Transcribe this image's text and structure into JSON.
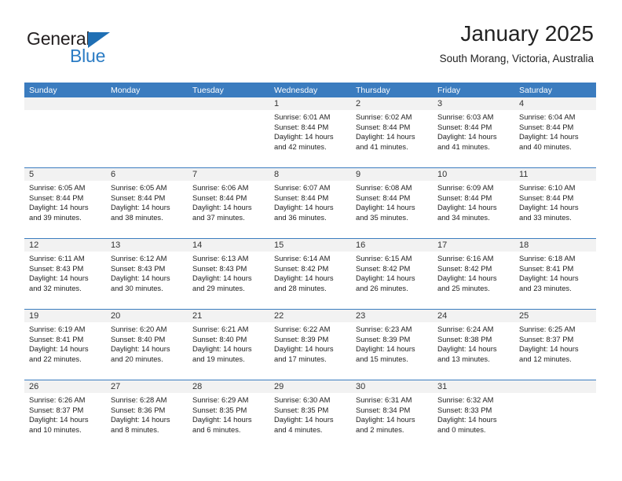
{
  "brand": {
    "name_top": "General",
    "name_bottom": "Blue",
    "accent_color": "#2b7cc4",
    "triangle_color": "#1f6fb4"
  },
  "header": {
    "title": "January 2025",
    "subtitle": "South Morang, Victoria, Australia"
  },
  "calendar": {
    "header_bg": "#3b7cbf",
    "daynum_bg": "#f2f2f2",
    "weekdays": [
      "Sunday",
      "Monday",
      "Tuesday",
      "Wednesday",
      "Thursday",
      "Friday",
      "Saturday"
    ],
    "weeks": [
      [
        {
          "day": "",
          "lines": []
        },
        {
          "day": "",
          "lines": []
        },
        {
          "day": "",
          "lines": []
        },
        {
          "day": "1",
          "lines": [
            "Sunrise: 6:01 AM",
            "Sunset: 8:44 PM",
            "Daylight: 14 hours",
            "and 42 minutes."
          ]
        },
        {
          "day": "2",
          "lines": [
            "Sunrise: 6:02 AM",
            "Sunset: 8:44 PM",
            "Daylight: 14 hours",
            "and 41 minutes."
          ]
        },
        {
          "day": "3",
          "lines": [
            "Sunrise: 6:03 AM",
            "Sunset: 8:44 PM",
            "Daylight: 14 hours",
            "and 41 minutes."
          ]
        },
        {
          "day": "4",
          "lines": [
            "Sunrise: 6:04 AM",
            "Sunset: 8:44 PM",
            "Daylight: 14 hours",
            "and 40 minutes."
          ]
        }
      ],
      [
        {
          "day": "5",
          "lines": [
            "Sunrise: 6:05 AM",
            "Sunset: 8:44 PM",
            "Daylight: 14 hours",
            "and 39 minutes."
          ]
        },
        {
          "day": "6",
          "lines": [
            "Sunrise: 6:05 AM",
            "Sunset: 8:44 PM",
            "Daylight: 14 hours",
            "and 38 minutes."
          ]
        },
        {
          "day": "7",
          "lines": [
            "Sunrise: 6:06 AM",
            "Sunset: 8:44 PM",
            "Daylight: 14 hours",
            "and 37 minutes."
          ]
        },
        {
          "day": "8",
          "lines": [
            "Sunrise: 6:07 AM",
            "Sunset: 8:44 PM",
            "Daylight: 14 hours",
            "and 36 minutes."
          ]
        },
        {
          "day": "9",
          "lines": [
            "Sunrise: 6:08 AM",
            "Sunset: 8:44 PM",
            "Daylight: 14 hours",
            "and 35 minutes."
          ]
        },
        {
          "day": "10",
          "lines": [
            "Sunrise: 6:09 AM",
            "Sunset: 8:44 PM",
            "Daylight: 14 hours",
            "and 34 minutes."
          ]
        },
        {
          "day": "11",
          "lines": [
            "Sunrise: 6:10 AM",
            "Sunset: 8:44 PM",
            "Daylight: 14 hours",
            "and 33 minutes."
          ]
        }
      ],
      [
        {
          "day": "12",
          "lines": [
            "Sunrise: 6:11 AM",
            "Sunset: 8:43 PM",
            "Daylight: 14 hours",
            "and 32 minutes."
          ]
        },
        {
          "day": "13",
          "lines": [
            "Sunrise: 6:12 AM",
            "Sunset: 8:43 PM",
            "Daylight: 14 hours",
            "and 30 minutes."
          ]
        },
        {
          "day": "14",
          "lines": [
            "Sunrise: 6:13 AM",
            "Sunset: 8:43 PM",
            "Daylight: 14 hours",
            "and 29 minutes."
          ]
        },
        {
          "day": "15",
          "lines": [
            "Sunrise: 6:14 AM",
            "Sunset: 8:42 PM",
            "Daylight: 14 hours",
            "and 28 minutes."
          ]
        },
        {
          "day": "16",
          "lines": [
            "Sunrise: 6:15 AM",
            "Sunset: 8:42 PM",
            "Daylight: 14 hours",
            "and 26 minutes."
          ]
        },
        {
          "day": "17",
          "lines": [
            "Sunrise: 6:16 AM",
            "Sunset: 8:42 PM",
            "Daylight: 14 hours",
            "and 25 minutes."
          ]
        },
        {
          "day": "18",
          "lines": [
            "Sunrise: 6:18 AM",
            "Sunset: 8:41 PM",
            "Daylight: 14 hours",
            "and 23 minutes."
          ]
        }
      ],
      [
        {
          "day": "19",
          "lines": [
            "Sunrise: 6:19 AM",
            "Sunset: 8:41 PM",
            "Daylight: 14 hours",
            "and 22 minutes."
          ]
        },
        {
          "day": "20",
          "lines": [
            "Sunrise: 6:20 AM",
            "Sunset: 8:40 PM",
            "Daylight: 14 hours",
            "and 20 minutes."
          ]
        },
        {
          "day": "21",
          "lines": [
            "Sunrise: 6:21 AM",
            "Sunset: 8:40 PM",
            "Daylight: 14 hours",
            "and 19 minutes."
          ]
        },
        {
          "day": "22",
          "lines": [
            "Sunrise: 6:22 AM",
            "Sunset: 8:39 PM",
            "Daylight: 14 hours",
            "and 17 minutes."
          ]
        },
        {
          "day": "23",
          "lines": [
            "Sunrise: 6:23 AM",
            "Sunset: 8:39 PM",
            "Daylight: 14 hours",
            "and 15 minutes."
          ]
        },
        {
          "day": "24",
          "lines": [
            "Sunrise: 6:24 AM",
            "Sunset: 8:38 PM",
            "Daylight: 14 hours",
            "and 13 minutes."
          ]
        },
        {
          "day": "25",
          "lines": [
            "Sunrise: 6:25 AM",
            "Sunset: 8:37 PM",
            "Daylight: 14 hours",
            "and 12 minutes."
          ]
        }
      ],
      [
        {
          "day": "26",
          "lines": [
            "Sunrise: 6:26 AM",
            "Sunset: 8:37 PM",
            "Daylight: 14 hours",
            "and 10 minutes."
          ]
        },
        {
          "day": "27",
          "lines": [
            "Sunrise: 6:28 AM",
            "Sunset: 8:36 PM",
            "Daylight: 14 hours",
            "and 8 minutes."
          ]
        },
        {
          "day": "28",
          "lines": [
            "Sunrise: 6:29 AM",
            "Sunset: 8:35 PM",
            "Daylight: 14 hours",
            "and 6 minutes."
          ]
        },
        {
          "day": "29",
          "lines": [
            "Sunrise: 6:30 AM",
            "Sunset: 8:35 PM",
            "Daylight: 14 hours",
            "and 4 minutes."
          ]
        },
        {
          "day": "30",
          "lines": [
            "Sunrise: 6:31 AM",
            "Sunset: 8:34 PM",
            "Daylight: 14 hours",
            "and 2 minutes."
          ]
        },
        {
          "day": "31",
          "lines": [
            "Sunrise: 6:32 AM",
            "Sunset: 8:33 PM",
            "Daylight: 14 hours",
            "and 0 minutes."
          ]
        },
        {
          "day": "",
          "lines": []
        }
      ]
    ]
  }
}
